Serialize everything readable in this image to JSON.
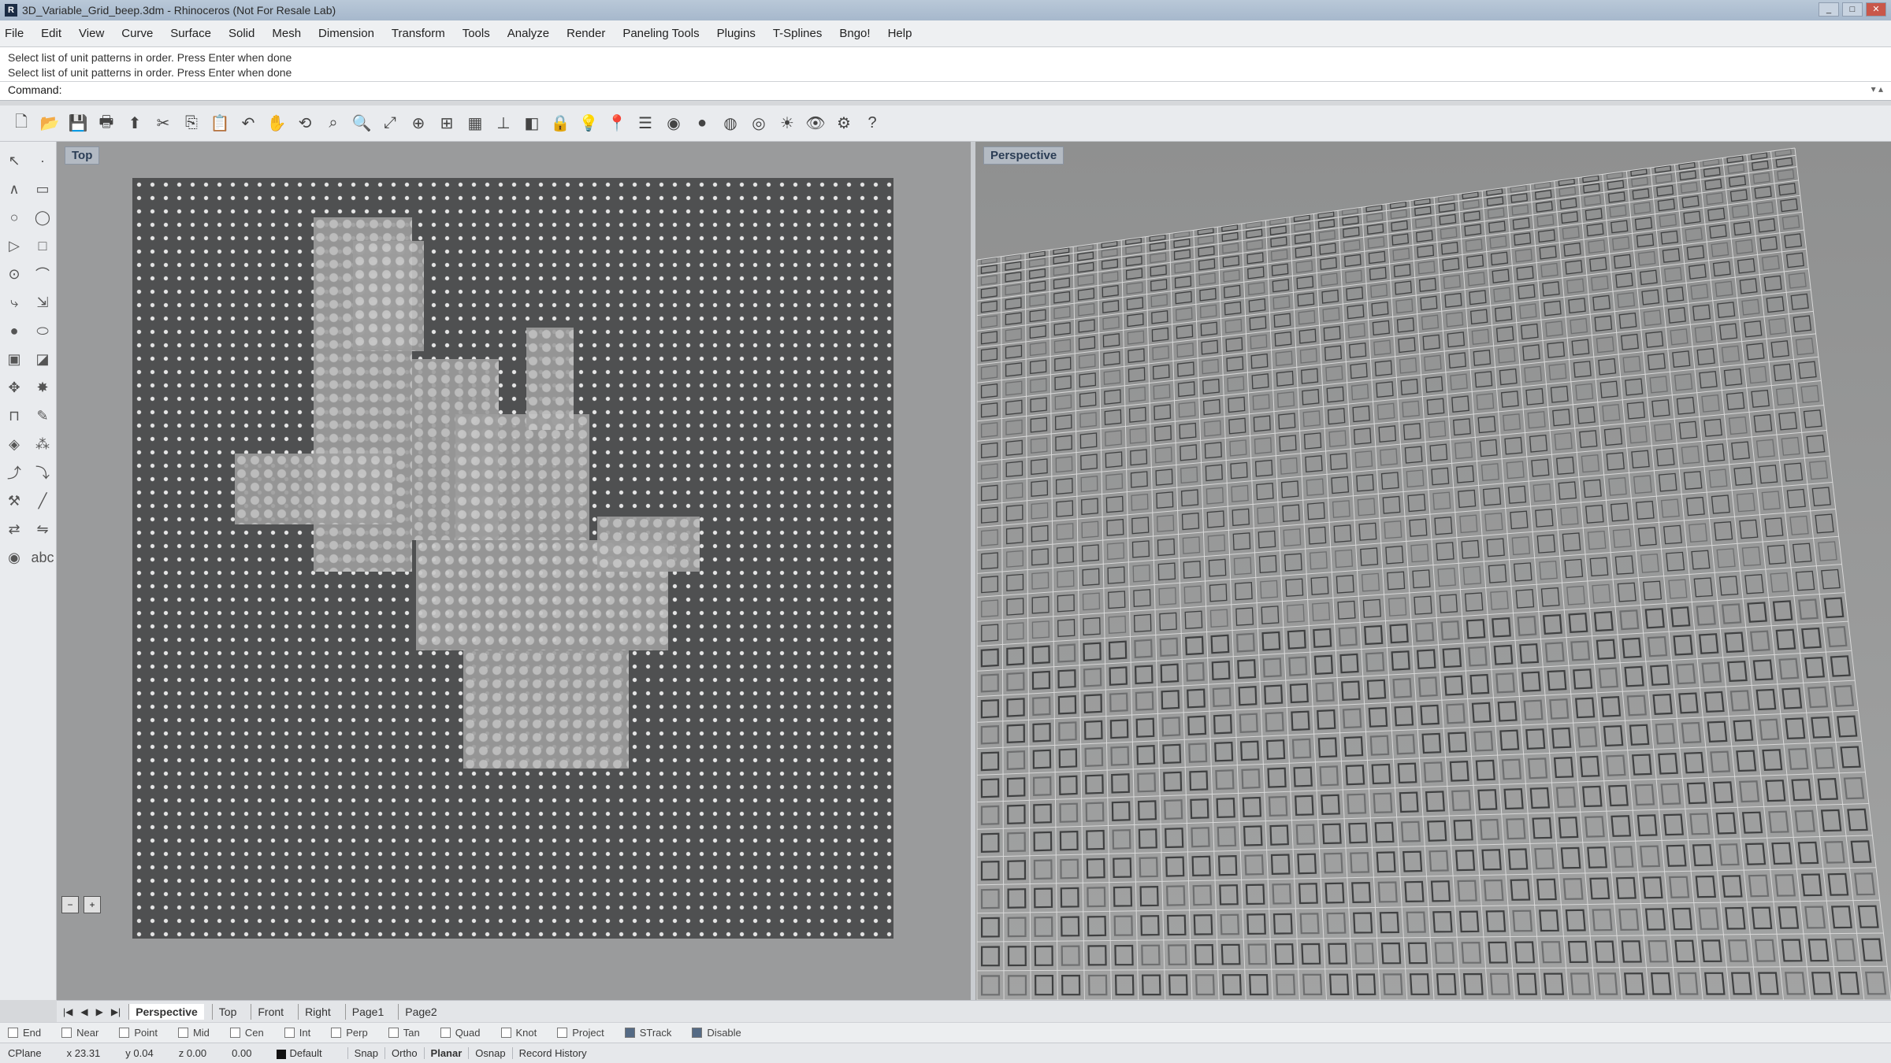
{
  "window": {
    "title": "3D_Variable_Grid_beep.3dm - Rhinoceros (Not For Resale Lab)",
    "buttons": [
      "_",
      "□",
      "✕"
    ]
  },
  "menu": [
    "File",
    "Edit",
    "View",
    "Curve",
    "Surface",
    "Solid",
    "Mesh",
    "Dimension",
    "Transform",
    "Tools",
    "Analyze",
    "Render",
    "Paneling Tools",
    "Plugins",
    "T-Splines",
    "Bngo!",
    "Help"
  ],
  "command_history": [
    "Select list of unit patterns in order. Press Enter when done",
    "Select list of unit patterns in order. Press Enter when done"
  ],
  "command_prompt": "Command:",
  "toolbar_icons": [
    "new-icon",
    "open-icon",
    "save-icon",
    "print-icon",
    "import-icon",
    "cut-icon",
    "copy-icon",
    "paste-icon",
    "undo-icon",
    "pan-icon",
    "rotate-view-icon",
    "zoom-window-icon",
    "zoom-dynamic-icon",
    "zoom-extents-icon",
    "zoom-selected-icon",
    "4-view-icon",
    "grid-icon",
    "cplane-icon",
    "hide-icon",
    "lock-icon",
    "lightbulb-icon",
    "pin-icon",
    "layers-icon",
    "render-icon",
    "material-icon",
    "sphere-icon",
    "globe-icon",
    "sun-icon",
    "eye-icon",
    "options-icon",
    "help-icon"
  ],
  "toolbar_glyphs": [
    "🗋",
    "📂",
    "💾",
    "🖶",
    "⬆",
    "✂",
    "⎘",
    "📋",
    "↶",
    "✋",
    "⟲",
    "⌕",
    "🔍",
    "⤢",
    "⊕",
    "⊞",
    "▦",
    "⊥",
    "◧",
    "🔒",
    "💡",
    "📍",
    "☰",
    "◉",
    "●",
    "◍",
    "◎",
    "☀",
    "👁",
    "⚙",
    "?"
  ],
  "sidebar_icons": [
    {
      "name": "select-icon",
      "glyph": "↖"
    },
    {
      "name": "select-points-icon",
      "glyph": "·"
    },
    {
      "name": "polyline-icon",
      "glyph": "∧"
    },
    {
      "name": "rectangle-icon",
      "glyph": "▭"
    },
    {
      "name": "circle-icon",
      "glyph": "○"
    },
    {
      "name": "ellipse-icon",
      "glyph": "◯"
    },
    {
      "name": "polygon-icon",
      "glyph": "▷"
    },
    {
      "name": "rectangle2-icon",
      "glyph": "□"
    },
    {
      "name": "curve-icon",
      "glyph": "⊙"
    },
    {
      "name": "arc-icon",
      "glyph": "⌒"
    },
    {
      "name": "fillet-icon",
      "glyph": "⤷"
    },
    {
      "name": "offset-icon",
      "glyph": "⇲"
    },
    {
      "name": "sphere-icon",
      "glyph": "●"
    },
    {
      "name": "capsule-icon",
      "glyph": "⬭"
    },
    {
      "name": "box-icon",
      "glyph": "▣"
    },
    {
      "name": "surface-icon",
      "glyph": "◪"
    },
    {
      "name": "move-icon",
      "glyph": "✥"
    },
    {
      "name": "explode-icon",
      "glyph": "✸"
    },
    {
      "name": "boolean-icon",
      "glyph": "⊓"
    },
    {
      "name": "pencil-icon",
      "glyph": "✎"
    },
    {
      "name": "drop-icon",
      "glyph": "◈"
    },
    {
      "name": "shapes-icon",
      "glyph": "⁂"
    },
    {
      "name": "curve-tool-icon",
      "glyph": "⤴"
    },
    {
      "name": "curve-tool2-icon",
      "glyph": "⤵"
    },
    {
      "name": "hammer-icon",
      "glyph": "⚒"
    },
    {
      "name": "brush-icon",
      "glyph": "╱"
    },
    {
      "name": "transform-icon",
      "glyph": "⇄"
    },
    {
      "name": "mirror-icon",
      "glyph": "⇋"
    },
    {
      "name": "sphere2-icon",
      "glyph": "◉"
    },
    {
      "name": "label-icon",
      "glyph": "abc"
    }
  ],
  "viewports": {
    "top": {
      "label": "Top"
    },
    "perspective": {
      "label": "Perspective"
    }
  },
  "tabs": {
    "nav": [
      "|◀",
      "◀",
      "▶",
      "▶|"
    ],
    "items": [
      "Perspective",
      "Top",
      "Front",
      "Right",
      "Page1",
      "Page2"
    ],
    "active": "Perspective"
  },
  "osnap": [
    {
      "label": "End",
      "on": false
    },
    {
      "label": "Near",
      "on": false
    },
    {
      "label": "Point",
      "on": false
    },
    {
      "label": "Mid",
      "on": false
    },
    {
      "label": "Cen",
      "on": false
    },
    {
      "label": "Int",
      "on": false
    },
    {
      "label": "Perp",
      "on": false
    },
    {
      "label": "Tan",
      "on": false
    },
    {
      "label": "Quad",
      "on": false
    },
    {
      "label": "Knot",
      "on": false
    },
    {
      "label": "Project",
      "on": false
    },
    {
      "label": "STrack",
      "on": true
    },
    {
      "label": "Disable",
      "on": true
    }
  ],
  "status": {
    "cplane": "CPlane",
    "x": "x 23.31",
    "y": "y 0.04",
    "z": "z 0.00",
    "dist": "0.00",
    "layer": "Default",
    "panes": [
      {
        "label": "Snap",
        "on": false
      },
      {
        "label": "Ortho",
        "on": false
      },
      {
        "label": "Planar",
        "on": true
      },
      {
        "label": "Osnap",
        "on": false
      },
      {
        "label": "Record History",
        "on": false
      }
    ]
  }
}
